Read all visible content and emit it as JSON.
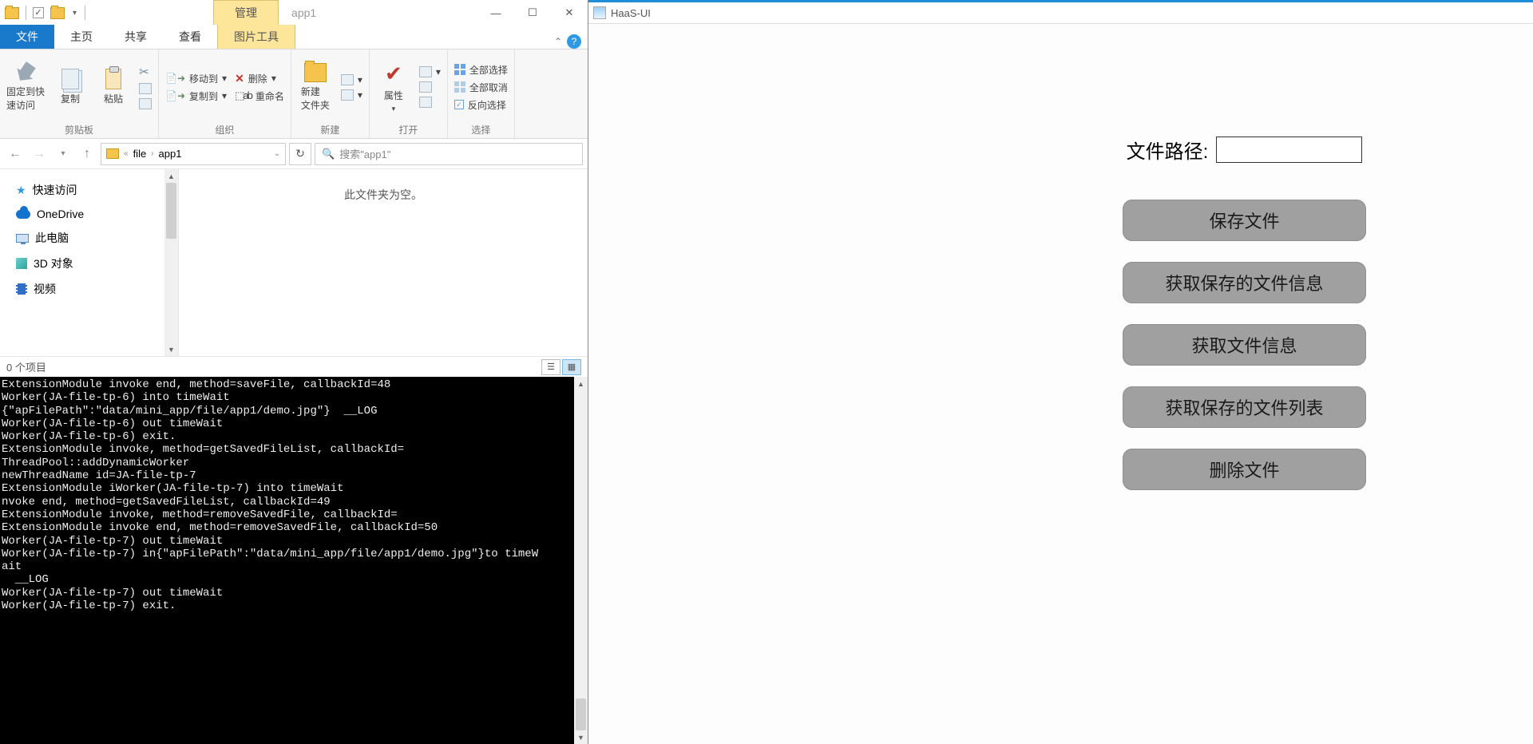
{
  "explorer": {
    "manage_tab": "管理",
    "window_title": "app1",
    "tabs": {
      "file": "文件",
      "home": "主页",
      "share": "共享",
      "view": "查看",
      "picture_tools": "图片工具"
    },
    "ribbon": {
      "clipboard_group": "剪贴板",
      "pin": "固定到快\n速访问",
      "copy": "复制",
      "paste": "粘贴",
      "organize_group": "组织",
      "move_to": "移动到",
      "copy_to": "复制到",
      "delete": "删除",
      "rename": "重命名",
      "new_group": "新建",
      "new_folder": "新建\n文件夹",
      "open_group": "打开",
      "properties": "属性",
      "select_group": "选择",
      "select_all": "全部选择",
      "deselect_all": "全部取消",
      "invert": "反向选择"
    },
    "breadcrumb": {
      "p1": "file",
      "p2": "app1"
    },
    "search_placeholder": "搜索\"app1\"",
    "nav": {
      "quick": "快速访问",
      "onedrive": "OneDrive",
      "thispc": "此电脑",
      "objects3d": "3D 对象",
      "videos": "视频"
    },
    "empty_msg": "此文件夹为空。",
    "status": "0 个项目"
  },
  "terminal_lines": [
    "ExtensionModule invoke end, method=saveFile, callbackId=48",
    "Worker(JA-file-tp-6) into timeWait",
    "{\"apFilePath\":\"data/mini_app/file/app1/demo.jpg\"}  __LOG",
    "Worker(JA-file-tp-6) out timeWait",
    "Worker(JA-file-tp-6) exit.",
    "ExtensionModule invoke, method=getSavedFileList, callbackId=",
    "ThreadPool::addDynamicWorker",
    "newThreadName id=JA-file-tp-7",
    "ExtensionModule iWorker(JA-file-tp-7) into timeWait",
    "nvoke end, method=getSavedFileList, callbackId=49",
    "ExtensionModule invoke, method=removeSavedFile, callbackId=",
    "ExtensionModule invoke end, method=removeSavedFile, callbackId=50",
    "Worker(JA-file-tp-7) out timeWait",
    "Worker(JA-file-tp-7) in{\"apFilePath\":\"data/mini_app/file/app1/demo.jpg\"}to timeW",
    "ait",
    "  __LOG",
    "Worker(JA-file-tp-7) out timeWait",
    "Worker(JA-file-tp-7) exit."
  ],
  "haas": {
    "title": "HaaS-UI",
    "path_label": "文件路径:",
    "btn_save": "保存文件",
    "btn_get_saved_info": "获取保存的文件信息",
    "btn_get_info": "获取文件信息",
    "btn_get_list": "获取保存的文件列表",
    "btn_delete": "删除文件"
  }
}
